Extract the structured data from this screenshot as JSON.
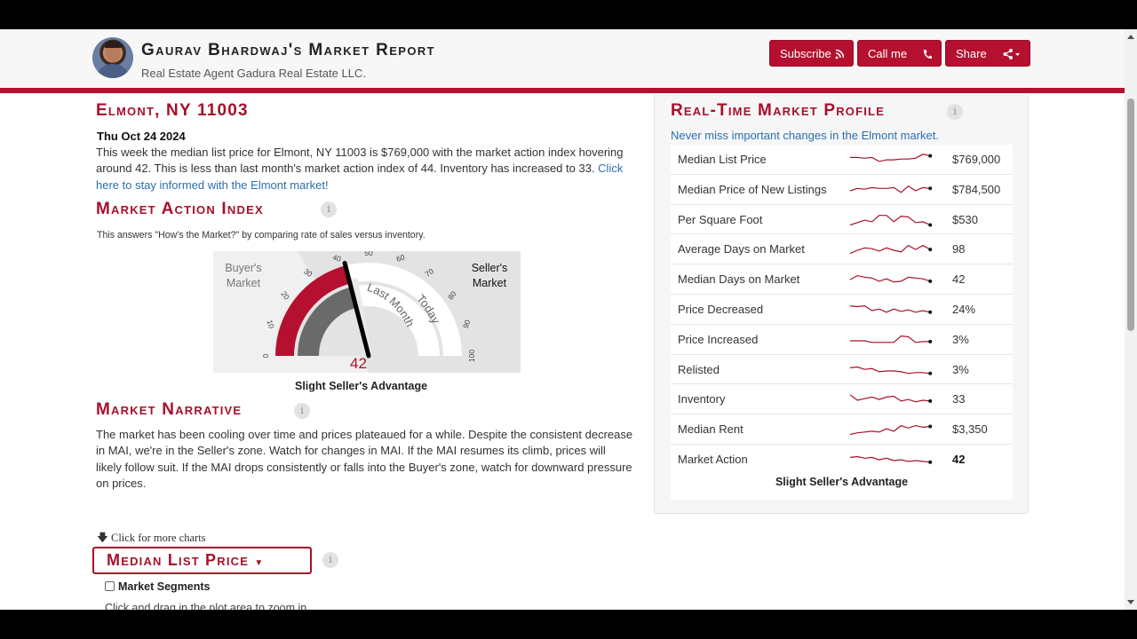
{
  "header": {
    "title": "Gaurav Bhardwaj's Market Report",
    "subtitle": "Real Estate Agent Gadura Real Estate LLC.",
    "buttons": [
      {
        "label": "Subscribe",
        "icon": "rss-icon"
      },
      {
        "label": "Call me",
        "icon": "phone-icon"
      },
      {
        "label": "Share",
        "icon": "share-icon"
      }
    ]
  },
  "location": {
    "title": "Elmont, NY 11003",
    "date": "Thu Oct 24 2024",
    "summary": "This week the median list price for Elmont, NY 11003 is $769,000 with the market action index hovering around 42. This is less than last month's market action index of 44. Inventory has increased to 33. ",
    "summary_link": "Click here to stay informed with the Elmont market!"
  },
  "mai": {
    "title": "Market Action Index",
    "description": "This answers \"How's the Market?\" by comparing rate of sales versus inventory.",
    "gauge": {
      "buyers_label_1": "Buyer's",
      "buyers_label_2": "Market",
      "sellers_label_1": "Seller's",
      "sellers_label_2": "Market",
      "ticks": [
        "0",
        "10",
        "20",
        "30",
        "40",
        "50",
        "60",
        "70",
        "80",
        "90",
        "100"
      ],
      "last_month_label": "Last Month",
      "today_label": "Today",
      "today_value": 42,
      "last_month_value": 44,
      "value_text": "42"
    },
    "caption": "Slight Seller's Advantage"
  },
  "narrative": {
    "title": "Market Narrative",
    "text": "The market has been cooling over time and prices plateaued for a while. Despite the consistent decrease in MAI, we're in the Seller's zone. Watch for changes in MAI. If the MAI resumes its climb, prices will likely follow suit. If the MAI drops consistently or falls into the Buyer's zone, watch for downward pressure on prices."
  },
  "charts": {
    "more_link": "Click for more charts",
    "dropdown_label": "Median List Price",
    "segments_label": "Market Segments",
    "zoom_hint": "Click and drag in the plot area to zoom in"
  },
  "profile": {
    "title": "Real-Time Market Profile",
    "subtitle": "Never miss important changes in the Elmont market.",
    "rows": [
      {
        "label": "Median List Price",
        "value": "$769,000"
      },
      {
        "label": "Median Price of New Listings",
        "value": "$784,500"
      },
      {
        "label": "Per Square Foot",
        "value": "$530"
      },
      {
        "label": "Average Days on Market",
        "value": "98"
      },
      {
        "label": "Median Days on Market",
        "value": "42"
      },
      {
        "label": "Price Decreased",
        "value": "24%"
      },
      {
        "label": "Price Increased",
        "value": "3%"
      },
      {
        "label": "Relisted",
        "value": "3%"
      },
      {
        "label": "Inventory",
        "value": "33"
      },
      {
        "label": "Median Rent",
        "value": "$3,350"
      },
      {
        "label": "Market Action",
        "value": "42"
      }
    ],
    "caption": "Slight Seller's Advantage"
  },
  "colors": {
    "brand": "#b5102f",
    "link": "#2a6fb0",
    "title": "#a8102a"
  }
}
